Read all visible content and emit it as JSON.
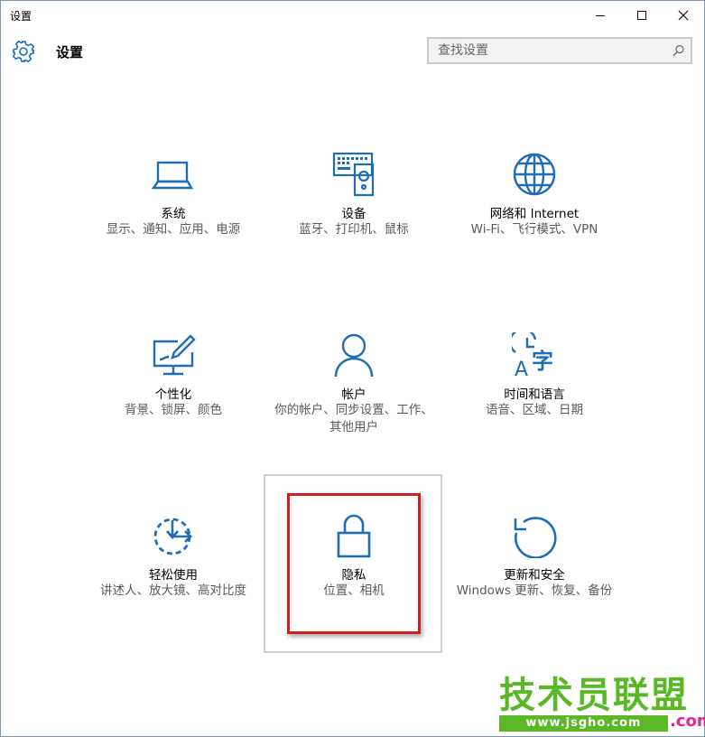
{
  "window": {
    "title": "设置",
    "minimize_glyph": "—",
    "maximize_glyph": "☐",
    "close_glyph": "✕"
  },
  "header": {
    "title": "设置",
    "icon": "gear-icon"
  },
  "search": {
    "placeholder": "查找设置",
    "icon": "search-icon"
  },
  "accent_color": "#1e6db5",
  "tiles": [
    {
      "name": "system",
      "title": "系统",
      "desc": "显示、通知、应用、电源",
      "icon": "laptop-icon"
    },
    {
      "name": "devices",
      "title": "设备",
      "desc": "蓝牙、打印机、鼠标",
      "icon": "keyboard-speaker-icon"
    },
    {
      "name": "network",
      "title": "网络和 Internet",
      "desc": "Wi-Fi、飞行模式、VPN",
      "icon": "globe-icon"
    },
    {
      "name": "personalization",
      "title": "个性化",
      "desc": "背景、锁屏、颜色",
      "icon": "monitor-pen-icon"
    },
    {
      "name": "accounts",
      "title": "帐户",
      "desc": "你的帐户、同步设置、工作、其他用户",
      "icon": "person-icon"
    },
    {
      "name": "time-language",
      "title": "时间和语言",
      "desc": "语音、区域、日期",
      "icon": "clock-language-icon"
    },
    {
      "name": "ease-of-access",
      "title": "轻松使用",
      "desc": "讲述人、放大镜、高对比度",
      "icon": "ease-of-access-icon"
    },
    {
      "name": "privacy",
      "title": "隐私",
      "desc": "位置、相机",
      "icon": "lock-icon"
    },
    {
      "name": "update-security",
      "title": "更新和安全",
      "desc": "Windows 更新、恢复、备份",
      "icon": "refresh-icon"
    }
  ],
  "watermark": {
    "main": "技术员联盟",
    "url": "www.jsgho.com",
    "suffix": ".com",
    "brand_color": "#5ab826",
    "suffix_color": "#e0288c"
  }
}
